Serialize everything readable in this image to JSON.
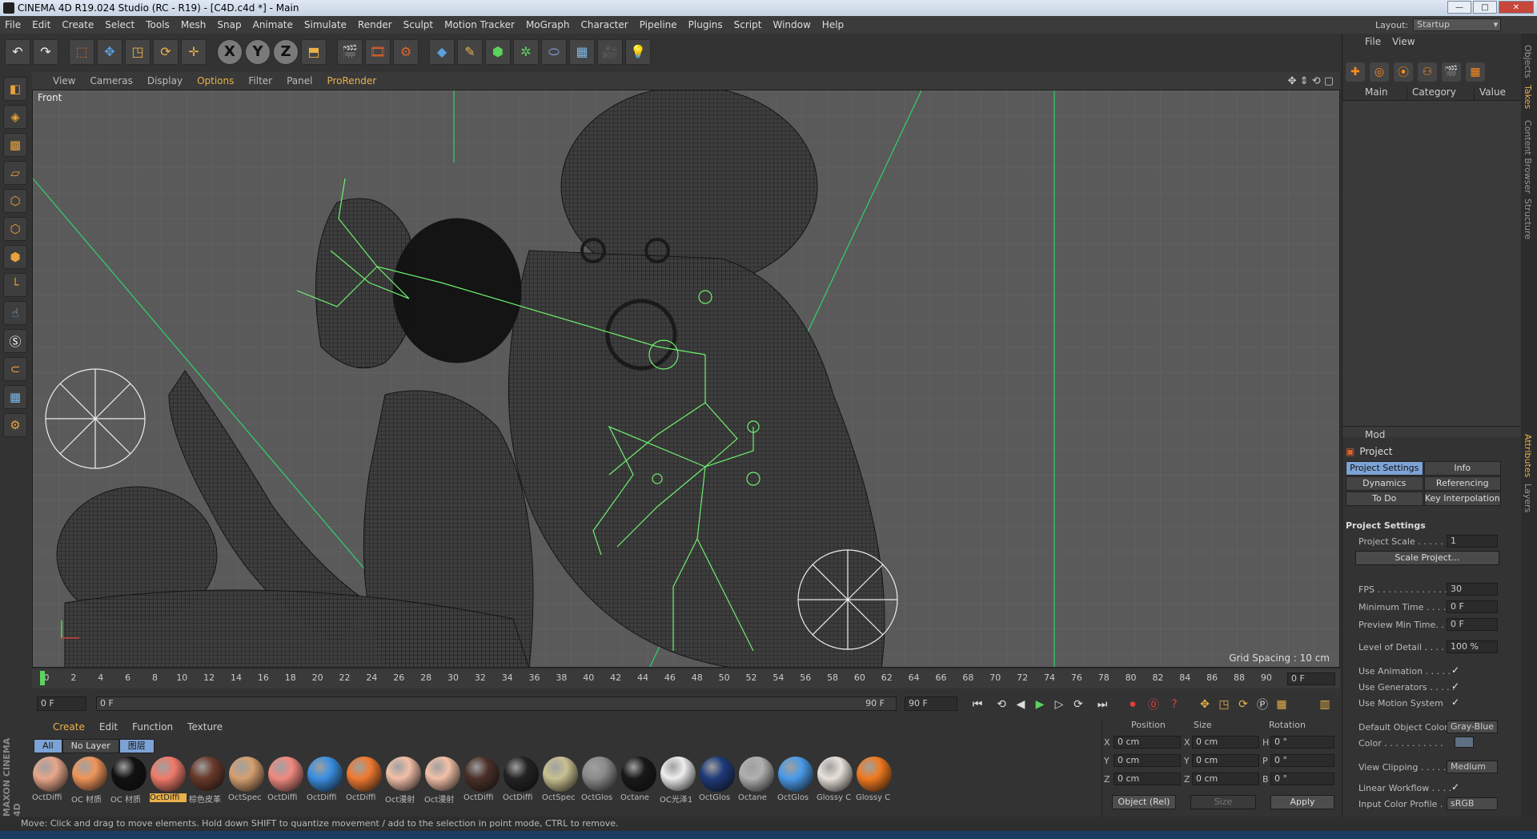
{
  "window": {
    "title": "CINEMA 4D R19.024 Studio (RC - R19) - [C4D.c4d *] - Main",
    "minimize": "—",
    "maximize": "□",
    "close": "✕"
  },
  "menubar": [
    "File",
    "Edit",
    "Create",
    "Select",
    "Tools",
    "Mesh",
    "Snap",
    "Animate",
    "Simulate",
    "Render",
    "Sculpt",
    "Motion Tracker",
    "MoGraph",
    "Character",
    "Pipeline",
    "Plugins",
    "Script",
    "Window",
    "Help"
  ],
  "layout": {
    "label": "Layout:",
    "value": "Startup"
  },
  "viewport": {
    "menu": [
      "View",
      "Cameras",
      "Display",
      "Options",
      "Filter",
      "Panel",
      "ProRender"
    ],
    "highlight": "Options",
    "label": "Front",
    "grid_spacing": "Grid Spacing : 10 cm"
  },
  "timeline": {
    "ticks": [
      "0",
      "2",
      "4",
      "6",
      "8",
      "10",
      "12",
      "14",
      "16",
      "18",
      "20",
      "22",
      "24",
      "26",
      "28",
      "30",
      "32",
      "34",
      "36",
      "38",
      "40",
      "42",
      "44",
      "46",
      "48",
      "50",
      "52",
      "54",
      "56",
      "58",
      "60",
      "62",
      "64",
      "66",
      "68",
      "70",
      "72",
      "74",
      "76",
      "78",
      "80",
      "82",
      "84",
      "86",
      "88",
      "90"
    ],
    "current_frame": "0 F"
  },
  "playbar": {
    "start": "0 F",
    "range_start": "0 F",
    "range_end": "90 F",
    "end": "90 F"
  },
  "material_manager": {
    "menu": [
      "Create",
      "Edit",
      "Function",
      "Texture"
    ],
    "layer_tabs": [
      "All",
      "No Layer",
      "图层"
    ],
    "materials": [
      {
        "label": "OctDiffi",
        "color": "#e8a68a"
      },
      {
        "label": "OC 材质",
        "color": "#f0955a"
      },
      {
        "label": "OC 材质",
        "color": "#111111"
      },
      {
        "label": "OctDiffi",
        "color": "#f07a6a",
        "selected": true
      },
      {
        "label": "棕色皮革",
        "color": "#6a3a2a"
      },
      {
        "label": "OctSpec",
        "color": "#d4a070"
      },
      {
        "label": "OctDiffi",
        "color": "#f08a80"
      },
      {
        "label": "OctDiffi",
        "color": "#3a8ee0"
      },
      {
        "label": "OctDiffi",
        "color": "#f07a30"
      },
      {
        "label": "Oct漫射",
        "color": "#f2c0a8"
      },
      {
        "label": "Oct漫射",
        "color": "#f2c0a8"
      },
      {
        "label": "OctDiffi",
        "color": "#4a3028"
      },
      {
        "label": "OctDiffi",
        "color": "#222222"
      },
      {
        "label": "OctSpec",
        "color": "#c8c090"
      },
      {
        "label": "OctGlos",
        "color": "#8a8a8a"
      },
      {
        "label": "Octane",
        "color": "#181818"
      },
      {
        "label": "OC光泽1",
        "color": "#eeeeee"
      },
      {
        "label": "OctGlos",
        "color": "#1e3a7a"
      },
      {
        "label": "Octane",
        "color": "#b0b0b0"
      },
      {
        "label": "OctGlos",
        "color": "#4a9ae8"
      },
      {
        "label": "Glossy C",
        "color": "#e8e2da"
      },
      {
        "label": "Glossy C",
        "color": "#f07a20"
      }
    ]
  },
  "coordinates": {
    "headers": [
      "Position",
      "Size",
      "Rotation"
    ],
    "rows": [
      {
        "axis": "X",
        "pos": "0 cm",
        "saxis": "X",
        "size": "0 cm",
        "raxis": "H",
        "rot": "0 °"
      },
      {
        "axis": "Y",
        "pos": "0 cm",
        "saxis": "Y",
        "size": "0 cm",
        "raxis": "P",
        "rot": "0 °"
      },
      {
        "axis": "Z",
        "pos": "0 cm",
        "saxis": "Z",
        "size": "0 cm",
        "raxis": "B",
        "rot": "0 °"
      }
    ],
    "mode": "Object (Rel)",
    "size_mode": "Size",
    "apply": "Apply"
  },
  "objects_panel": {
    "menu": [
      "File",
      "View"
    ],
    "columns": [
      "Main",
      "Category",
      "Value"
    ]
  },
  "attributes": {
    "menu": "Mod",
    "title": "Project",
    "tabs": [
      "Project Settings",
      "Info",
      "Dynamics",
      "Referencing",
      "To Do",
      "Key Interpolation"
    ],
    "section": "Project Settings",
    "project_scale_label": "Project Scale . . . . . . .",
    "project_scale": "1",
    "scale_button": "Scale Project...",
    "fps_label": "FPS . . . . . . . . . . . . . . .",
    "fps": "30",
    "min_time_label": "Minimum Time . . . . .",
    "min_time": "0 F",
    "preview_min_label": "Preview Min Time. . .",
    "preview_min": "0 F",
    "lod_label": "Level of Detail . . . . . .",
    "lod": "100 %",
    "use_animation": "Use Animation . . . . .",
    "use_generators": "Use Generators . . . . .",
    "use_motion": "Use Motion System",
    "default_color_label": "Default Object Color",
    "default_color": "Gray-Blue",
    "color_label": "Color . . . . . . . . . . .",
    "view_clipping_label": "View Clipping . . . . . .",
    "view_clipping": "Medium",
    "linear_workflow": "Linear Workflow . . . .",
    "input_profile_label": "Input Color Profile . .",
    "input_profile": "sRGB"
  },
  "side_tabs": [
    "Objects",
    "Takes",
    "Content Browser",
    "Structure",
    "Attributes",
    "Layers"
  ],
  "status": "Move: Click and drag to move elements. Hold down SHIFT to quantize movement / add to the selection in point mode, CTRL to remove.",
  "maxon": "MAXON CINEMA 4D"
}
